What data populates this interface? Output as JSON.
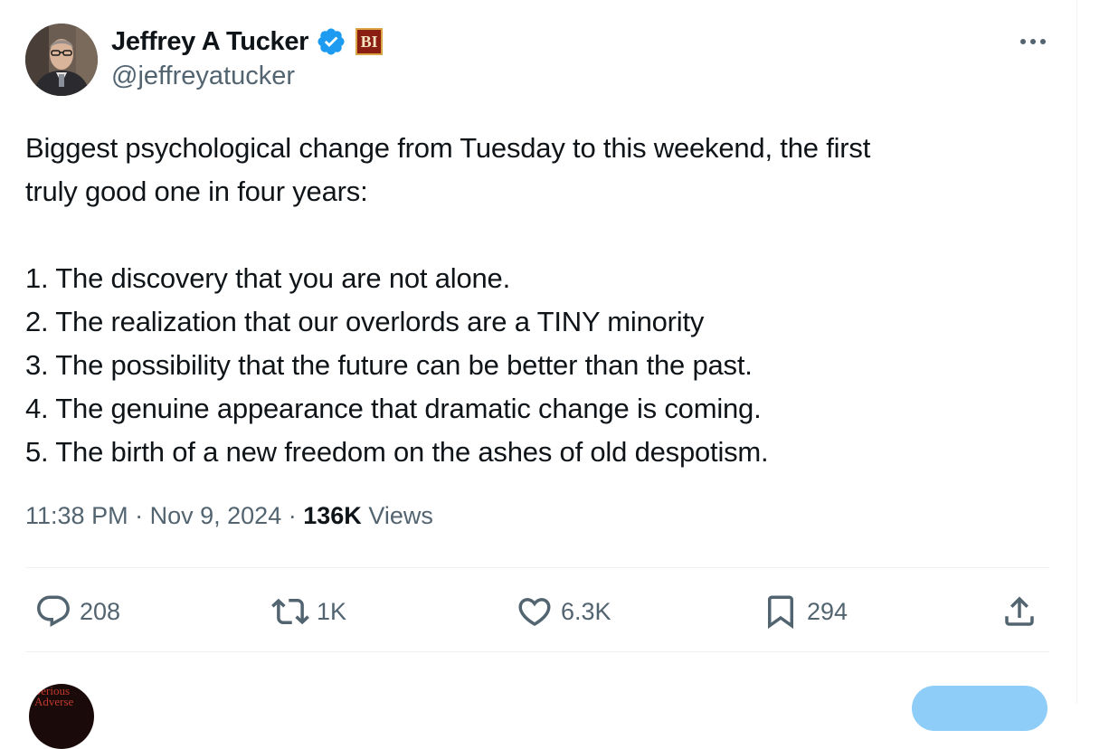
{
  "author": {
    "display_name": "Jeffrey A Tucker",
    "handle": "@jeffreyatucker",
    "affiliate_badge": "BI"
  },
  "tweet": {
    "text": "Biggest psychological change from Tuesday to this weekend, the first\ntruly good one in four years:\n\n1. The discovery that you are not alone.\n2. The realization that our overlords are a TINY minority\n3. The possibility that the future can be better than the past.\n4. The genuine appearance that dramatic change is coming.\n5. The birth of a new freedom on the ashes of old despotism.",
    "time": "11:38 PM",
    "date": "Nov 9, 2024",
    "separator": "·",
    "views_count": "136K",
    "views_label": "Views"
  },
  "actions": {
    "replies": "208",
    "reposts": "1K",
    "likes": "6.3K",
    "bookmarks": "294"
  },
  "next_post": {
    "avatar_text": "Serious Adverse"
  },
  "colors": {
    "verified_blue": "#1d9bf0",
    "muted_text": "#536471",
    "primary_text": "#0f1419",
    "divider": "#eff3f4"
  },
  "icons": [
    "verified-check-icon",
    "more-icon",
    "reply-icon",
    "repost-icon",
    "like-icon",
    "bookmark-icon",
    "share-icon"
  ]
}
